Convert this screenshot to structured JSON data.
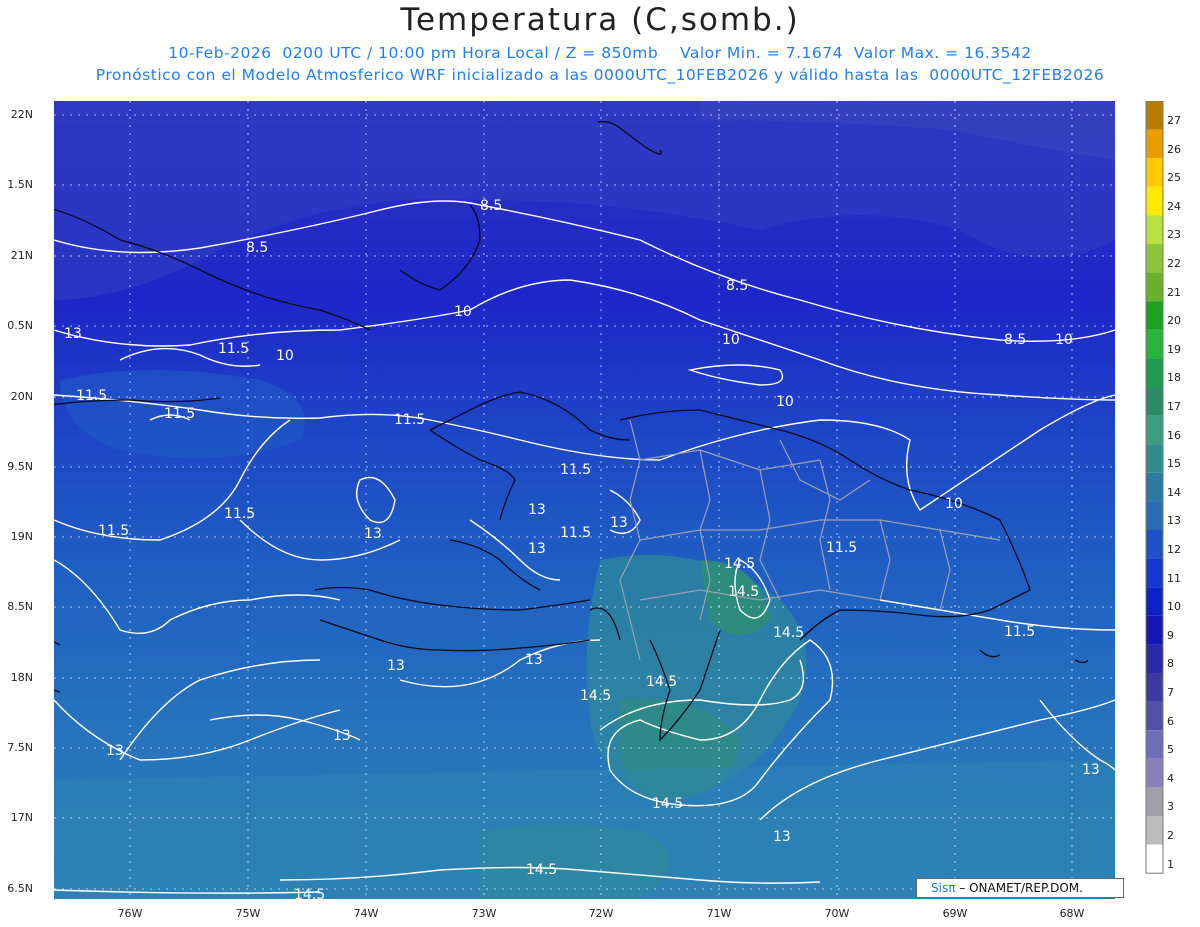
{
  "header": {
    "title": "Temperatura (C,somb.)",
    "line1": "10-Feb-2026  0200 UTC / 10:00 pm Hora Local / Z = 850mb    Valor Min. = 7.1674  Valor Max. = 16.3542",
    "line2": "Pronóstico con el Modelo Atmosferico WRF inicializado a las 0000UTC_10FEB2026 y válido hasta las  0000UTC_12FEB2026"
  },
  "credit": {
    "brand": "Sisπ",
    "text": "– ONAMET/REP.DOM."
  },
  "axes": {
    "lat_labels": [
      "22N",
      "1.5N",
      "21N",
      "0.5N",
      "20N",
      "9.5N",
      "19N",
      "8.5N",
      "18N",
      "7.5N",
      "17N",
      "6.5N"
    ],
    "lon_labels": [
      "76W",
      "75W",
      "74W",
      "73W",
      "72W",
      "71W",
      "70W",
      "69W",
      "68W"
    ]
  },
  "contours": {
    "labels": [
      "8.5",
      "8.5",
      "8.5",
      "8.5",
      "10",
      "10",
      "10",
      "10",
      "10",
      "10",
      "11.5",
      "11.5",
      "11.5",
      "11.5",
      "11.5",
      "11.5",
      "11.5",
      "11.5",
      "11.5",
      "11.5",
      "13",
      "13",
      "13",
      "13",
      "13",
      "13",
      "13",
      "13",
      "13",
      "13",
      "13",
      "14.5",
      "14.5",
      "14.5",
      "14.5",
      "14.5",
      "14.5",
      "14.5",
      "14.5"
    ]
  },
  "colorbar": {
    "labels": [
      "27",
      "26",
      "25",
      "24",
      "23",
      "22",
      "21",
      "20",
      "19",
      "18",
      "17",
      "16",
      "15",
      "14",
      "13",
      "12",
      "11",
      "10",
      "9",
      "8",
      "7",
      "6",
      "5",
      "4",
      "3",
      "2",
      "1"
    ],
    "colors": [
      "#b87d00",
      "#e89d00",
      "#ffc800",
      "#ffe800",
      "#b8e040",
      "#8cc43c",
      "#6ab02c",
      "#1ea020",
      "#28b43c",
      "#1f9a4e",
      "#2c8a66",
      "#3d9c80",
      "#2f8c8a",
      "#2a7aa4",
      "#2d6ab4",
      "#1f50c8",
      "#1438d0",
      "#0a22c8",
      "#1616b4",
      "#2a2aa8",
      "#3a3aa0",
      "#5050a8",
      "#6e6eb8",
      "#8c80b8",
      "#a0a0a8",
      "#bcbcbc",
      "#ffffff"
    ]
  },
  "field_colors": {
    "north": "#2d33bf",
    "mid": "#1c28c8",
    "band": "#1e5fc4",
    "south": "#2a7cb8",
    "green": "#2f8c8a"
  }
}
